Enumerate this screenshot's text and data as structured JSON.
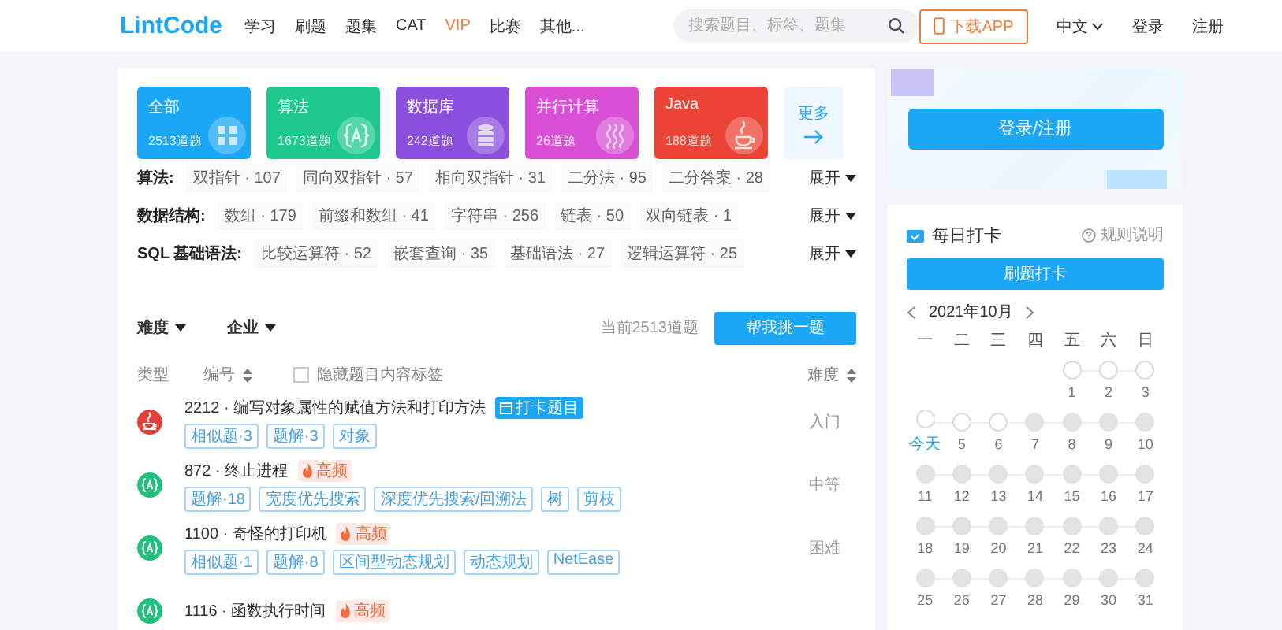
{
  "header": {
    "logo": "LintCode",
    "nav": [
      {
        "label": "学习",
        "color": "#333333"
      },
      {
        "label": "刷题",
        "color": "#333333"
      },
      {
        "label": "题集",
        "color": "#333333"
      },
      {
        "label": "CAT",
        "color": "#333333"
      },
      {
        "label": "VIP",
        "color": "#f07c3c"
      },
      {
        "label": "比赛",
        "color": "#333333"
      },
      {
        "label": "其他...",
        "color": "#333333"
      }
    ],
    "search": {
      "placeholder": "搜索题目、标签、题集"
    },
    "download": "下载APP",
    "language": "中文",
    "login": "登录",
    "register": "注册"
  },
  "categories": [
    {
      "title": "全部",
      "count": "2513道题",
      "color": "#1aa7f5",
      "kind": "grid"
    },
    {
      "title": "算法",
      "count": "1673道题",
      "color": "#1fc98d",
      "kind": "algorithm"
    },
    {
      "title": "数据库",
      "count": "242道题",
      "color": "#8a4fdc",
      "kind": "database"
    },
    {
      "title": "并行计算",
      "count": "26道题",
      "color": "#d94fd6",
      "kind": "parallel"
    },
    {
      "title": "Java",
      "count": "188道题",
      "color": "#eb4335",
      "kind": "java"
    }
  ],
  "more": "更多",
  "tag_groups": [
    {
      "label": "算法:",
      "tags": [
        "双指针 · 107",
        "同向双指针 · 57",
        "相向双指针 · 31",
        "二分法 · 95",
        "二分答案 · 28"
      ],
      "expand": "展开"
    },
    {
      "label": "数据结构:",
      "tags": [
        "数组 · 179",
        "前缀和数组 · 41",
        "字符串 · 256",
        "链表 · 50",
        "双向链表 · 1"
      ],
      "expand": "展开"
    },
    {
      "label": "SQL 基础语法:",
      "tags": [
        "比较运算符 · 52",
        "嵌套查询 · 35",
        "基础语法 · 27",
        "逻辑运算符 · 25"
      ],
      "expand": "展开"
    }
  ],
  "filters": [
    "难度",
    "企业"
  ],
  "total": "当前2513道题",
  "pick_button": "帮我挑一题",
  "list_header": {
    "type": "类型",
    "number": "编号",
    "hide_tags": {
      "label": "隐藏题目内容标签",
      "checked": false
    },
    "difficulty": "难度"
  },
  "problems": [
    {
      "kind": "java",
      "title": "2212 · 编写对象属性的赋值方法和打印方法",
      "badge": {
        "kind": "checkin",
        "label": "打卡题目"
      },
      "tags": [
        "相似题·3",
        "题解·3",
        "对象"
      ],
      "difficulty": "入门"
    },
    {
      "kind": "algorithm",
      "title": "872 · 终止进程",
      "badge": {
        "kind": "hot",
        "label": "高频"
      },
      "tags": [
        "题解·18",
        "宽度优先搜索",
        "深度优先搜索/回溯法",
        "树",
        "剪枝"
      ],
      "difficulty": "中等"
    },
    {
      "kind": "algorithm",
      "title": "1100 · 奇怪的打印机",
      "badge": {
        "kind": "hot",
        "label": "高频"
      },
      "tags": [
        "相似题·1",
        "题解·8",
        "区间型动态规划",
        "动态规划",
        "NetEase"
      ],
      "difficulty": "困难"
    },
    {
      "kind": "algorithm",
      "title": "1116 · 函数执行时间",
      "badge": {
        "kind": "hot",
        "label": "高频"
      }
    }
  ],
  "login_button": "登录/注册",
  "checkin": {
    "title": "每日打卡",
    "rules": "规则说明",
    "button": "刷题打卡",
    "month": "2021年10月",
    "weekdays": [
      "一",
      "二",
      "三",
      "四",
      "五",
      "六",
      "日"
    ],
    "weeks": [
      [
        {
          "label": "1",
          "locked": false,
          "today": false
        },
        {
          "label": "2",
          "locked": false,
          "today": false
        },
        {
          "label": "3",
          "locked": false,
          "today": false
        }
      ],
      [
        {
          "label": "今天",
          "locked": false,
          "today": true
        },
        {
          "label": "5",
          "locked": false,
          "today": false
        },
        {
          "label": "6",
          "locked": false,
          "today": false
        },
        {
          "label": "7",
          "locked": true,
          "today": false
        },
        {
          "label": "8",
          "locked": true,
          "today": false
        },
        {
          "label": "9",
          "locked": true,
          "today": false
        },
        {
          "label": "10",
          "locked": true,
          "today": false
        }
      ],
      [
        {
          "label": "11",
          "locked": true,
          "today": false
        },
        {
          "label": "12",
          "locked": true,
          "today": false
        },
        {
          "label": "13",
          "locked": true,
          "today": false
        },
        {
          "label": "14",
          "locked": true,
          "today": false
        },
        {
          "label": "15",
          "locked": true,
          "today": false
        },
        {
          "label": "16",
          "locked": true,
          "today": false
        },
        {
          "label": "17",
          "locked": true,
          "today": false
        }
      ],
      [
        {
          "label": "18",
          "locked": true,
          "today": false
        },
        {
          "label": "19",
          "locked": true,
          "today": false
        },
        {
          "label": "20",
          "locked": true,
          "today": false
        },
        {
          "label": "21",
          "locked": true,
          "today": false
        },
        {
          "label": "22",
          "locked": true,
          "today": false
        },
        {
          "label": "23",
          "locked": true,
          "today": false
        },
        {
          "label": "24",
          "locked": true,
          "today": false
        }
      ],
      [
        {
          "label": "25",
          "locked": true,
          "today": false
        },
        {
          "label": "26",
          "locked": true,
          "today": false
        },
        {
          "label": "27",
          "locked": true,
          "today": false
        },
        {
          "label": "28",
          "locked": true,
          "today": false
        },
        {
          "label": "29",
          "locked": true,
          "today": false
        },
        {
          "label": "30",
          "locked": true,
          "today": false
        },
        {
          "label": "31",
          "locked": true,
          "today": false
        }
      ]
    ]
  }
}
